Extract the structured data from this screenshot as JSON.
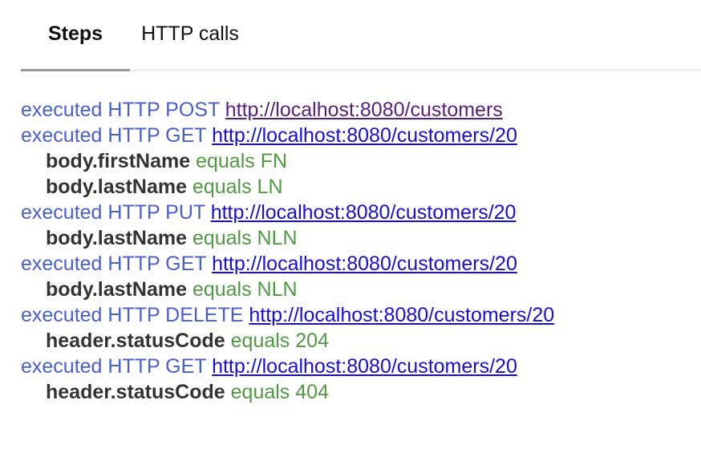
{
  "tabs": {
    "steps": "Steps",
    "http_calls": "HTTP calls"
  },
  "steps": {
    "s0": {
      "text": "executed HTTP POST",
      "url": "http://localhost:8080/customers"
    },
    "s1": {
      "text": "executed HTTP GET",
      "url": "http://localhost:8080/customers/20",
      "a0": {
        "field": "body.firstName",
        "check": "equals FN"
      },
      "a1": {
        "field": "body.lastName",
        "check": "equals LN"
      }
    },
    "s2": {
      "text": "executed HTTP PUT",
      "url": "http://localhost:8080/customers/20",
      "a0": {
        "field": "body.lastName",
        "check": "equals NLN"
      }
    },
    "s3": {
      "text": "executed HTTP GET",
      "url": "http://localhost:8080/customers/20",
      "a0": {
        "field": "body.lastName",
        "check": "equals NLN"
      }
    },
    "s4": {
      "text": "executed HTTP DELETE",
      "url": "http://localhost:8080/customers/20",
      "a0": {
        "field": "header.statusCode",
        "check": "equals 204"
      }
    },
    "s5": {
      "text": "executed HTTP GET",
      "url": "http://localhost:8080/customers/20",
      "a0": {
        "field": "header.statusCode",
        "check": "equals 404"
      }
    }
  },
  "colors": {
    "executed_text": "#4a5fcf",
    "link": "#1a0dd8",
    "visited_link": "#5a1f7a",
    "field": "#333333",
    "assertion": "#4e9a40",
    "active_tab_indicator": "#9a9a9a"
  }
}
